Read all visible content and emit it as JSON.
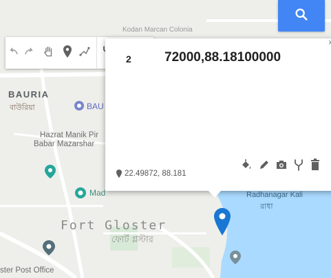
{
  "map": {
    "area_label_en": "BAURIA",
    "area_label_bn": "বাউরিয়া",
    "poi_bau": "BAU",
    "place_hazrat_line1": "Hazrat Manik Pir",
    "place_hazrat_line2": "Babar Mazarshar",
    "place_madhusudan": "Mad",
    "label_fort": "Fort Gloster",
    "label_fort_bn": "ফোর্ট গ্লস্টার",
    "label_radhanagar": "Radhanagar Kali",
    "label_radhanagar_bn": "রাধা",
    "label_post_office": "ster Post Office",
    "label_road_top": "Kodan Marcan Colonia",
    "water_color": "#aadaff",
    "road_color": "#ffffff"
  },
  "search": {
    "icon": "search-icon",
    "color": "#4285f4"
  },
  "toolbar": {
    "tools": [
      "undo-icon",
      "redo-icon",
      "pan-hand-icon",
      "add-marker-icon",
      "draw-line-icon",
      "route-icon",
      "measure-ruler-icon"
    ]
  },
  "popup": {
    "title": "72000,88.18100000",
    "title_prefix": "2",
    "coords": "22.49872, 88.181",
    "close_label": "×",
    "actions": [
      "paint-bucket-icon",
      "edit-pencil-icon",
      "camera-icon",
      "directions-icon",
      "delete-icon"
    ]
  },
  "marker": {
    "color": "#1976d2"
  }
}
